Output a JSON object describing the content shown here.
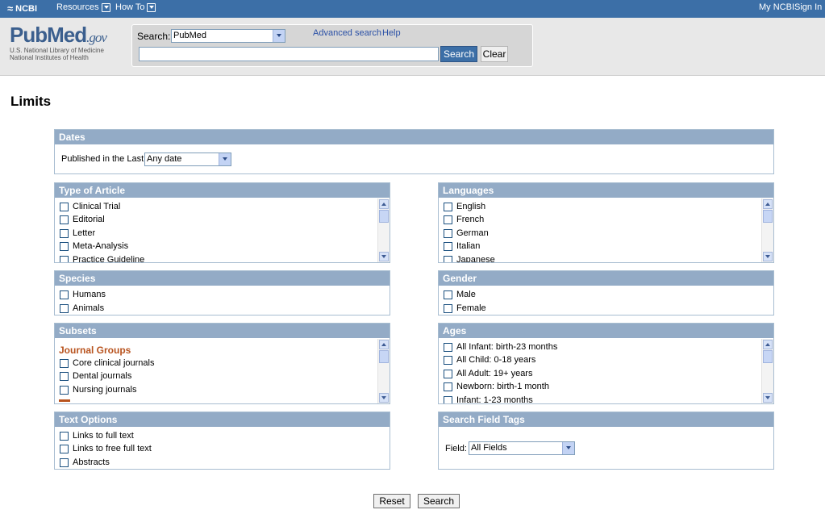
{
  "ncbi_bar": {
    "logo": "NCBI",
    "resources": "Resources",
    "howto": "How To",
    "my_ncbi": "My NCBI",
    "sign_in": "Sign In"
  },
  "header": {
    "logo": "PubMed",
    "logo_suffix": ".gov",
    "sub1": "U.S. National Library of Medicine",
    "sub2": "National Institutes of Health",
    "search_label": "Search:",
    "db_selected": "PubMed",
    "advanced_link": "Advanced search",
    "help_link": "Help",
    "term_value": "",
    "search_button": "Search",
    "clear_button": "Clear"
  },
  "page_title": "Limits",
  "dates": {
    "title": "Dates",
    "published_label": "Published in the Last:",
    "published_value": "Any date"
  },
  "type_of_article": {
    "title": "Type of Article",
    "items": [
      "Clinical Trial",
      "Editorial",
      "Letter",
      "Meta-Analysis",
      "Practice Guideline"
    ]
  },
  "languages": {
    "title": "Languages",
    "items": [
      "English",
      "French",
      "German",
      "Italian",
      "Japanese"
    ]
  },
  "species": {
    "title": "Species",
    "items": [
      "Humans",
      "Animals"
    ]
  },
  "gender": {
    "title": "Gender",
    "items": [
      "Male",
      "Female"
    ]
  },
  "subsets": {
    "title": "Subsets",
    "group_title": "Journal Groups",
    "items": [
      "Core clinical journals",
      "Dental journals",
      "Nursing journals"
    ]
  },
  "ages": {
    "title": "Ages",
    "items": [
      "All Infant: birth-23 months",
      "All Child: 0-18 years",
      "All Adult: 19+ years",
      "Newborn: birth-1 month",
      "Infant: 1-23 months"
    ]
  },
  "text_options": {
    "title": "Text Options",
    "items": [
      "Links to full text",
      "Links to free full text",
      "Abstracts"
    ]
  },
  "search_field_tags": {
    "title": "Search Field Tags",
    "field_label": "Field:",
    "field_value": "All Fields"
  },
  "footer": {
    "reset_button": "Reset",
    "search_button": "Search"
  }
}
